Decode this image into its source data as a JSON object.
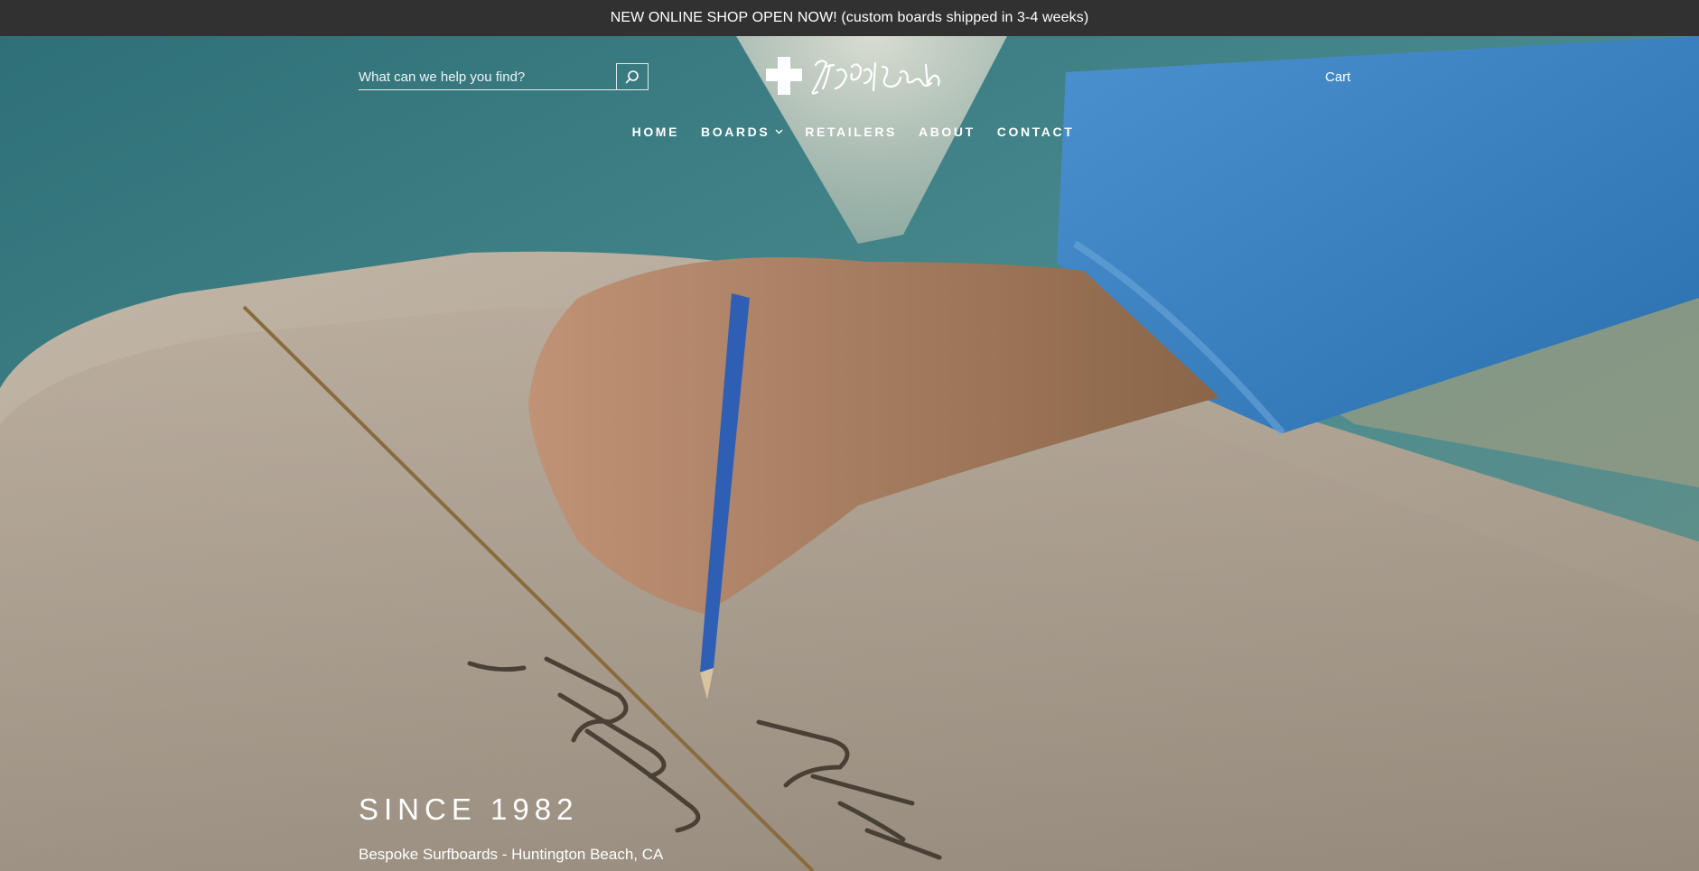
{
  "announcement": {
    "text": "NEW ONLINE SHOP OPEN NOW! (custom boards shipped in 3-4 weeks)"
  },
  "header": {
    "search": {
      "placeholder": "What can we help you find?",
      "button_icon": "search-icon"
    },
    "logo": {
      "icon": "plus-cross-icon",
      "wordmark": "Jed Noll Lawsen"
    },
    "cart_label": "Cart"
  },
  "nav": {
    "items": [
      {
        "label": "HOME"
      },
      {
        "label": "BOARDS",
        "has_dropdown": true,
        "dropdown_icon": "chevron-down-icon"
      },
      {
        "label": "RETAILERS"
      },
      {
        "label": "ABOUT"
      },
      {
        "label": "CONTACT"
      }
    ]
  },
  "hero": {
    "title": "SINCE 1982",
    "subtitle": "Bespoke Surfboards - Huntington Beach, CA",
    "image_description": "hand-signing-surfboard-photo"
  },
  "colors": {
    "announcement_bg": "#313131",
    "text": "#ffffff",
    "shirt": "#3a7fbf",
    "board": "#c9bdad",
    "wall": "#3b7f86"
  }
}
